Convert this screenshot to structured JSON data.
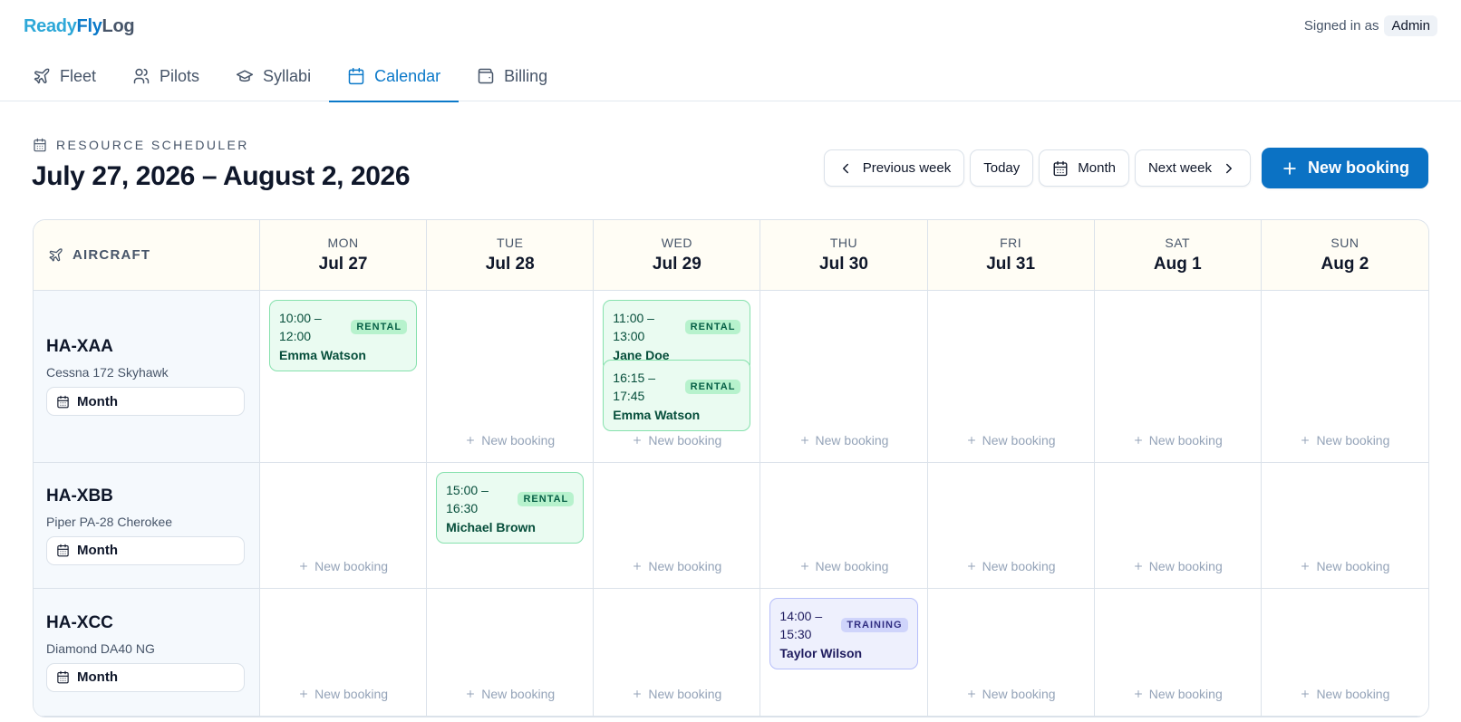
{
  "brand": {
    "part1": "Ready",
    "part2": "Fly",
    "part3": "Log"
  },
  "user": {
    "signed_in_label": "Signed in as",
    "name": "Admin"
  },
  "nav": {
    "tabs": [
      {
        "label": "Fleet",
        "icon": "plane-icon"
      },
      {
        "label": "Pilots",
        "icon": "users-icon"
      },
      {
        "label": "Syllabi",
        "icon": "graduation-cap-icon"
      },
      {
        "label": "Calendar",
        "icon": "calendar-icon",
        "active": true
      },
      {
        "label": "Billing",
        "icon": "wallet-icon"
      }
    ]
  },
  "page": {
    "eyebrow": "RESOURCE SCHEDULER",
    "title": "July 27, 2026 – August 2, 2026"
  },
  "toolbar": {
    "prev_week": "Previous week",
    "today": "Today",
    "month": "Month",
    "next_week": "Next week",
    "new_booking": "New booking"
  },
  "grid": {
    "corner_label": "AIRCRAFT",
    "days": [
      {
        "dow": "MON",
        "date": "Jul 27"
      },
      {
        "dow": "TUE",
        "date": "Jul 28"
      },
      {
        "dow": "WED",
        "date": "Jul 29"
      },
      {
        "dow": "THU",
        "date": "Jul 30"
      },
      {
        "dow": "FRI",
        "date": "Jul 31"
      },
      {
        "dow": "SAT",
        "date": "Aug 1"
      },
      {
        "dow": "SUN",
        "date": "Aug 2"
      }
    ],
    "new_booking_label": "New booking",
    "resources": [
      {
        "registration": "HA-XAA",
        "model": "Cessna 172 Skyhawk",
        "month_label": "Month"
      },
      {
        "registration": "HA-XBB",
        "model": "Piper PA-28 Cherokee",
        "month_label": "Month"
      },
      {
        "registration": "HA-XCC",
        "model": "Diamond DA40 NG",
        "month_label": "Month"
      }
    ],
    "bookings": [
      {
        "resource": 0,
        "day": 0,
        "time": "10:00 – 12:00",
        "tag": "RENTAL",
        "pilot": "Emma Watson"
      },
      {
        "resource": 0,
        "day": 2,
        "time": "11:00 – 13:00",
        "tag": "RENTAL",
        "pilot": "Jane Doe"
      },
      {
        "resource": 0,
        "day": 2,
        "time": "16:15 – 17:45",
        "tag": "RENTAL",
        "pilot": "Emma Watson"
      },
      {
        "resource": 1,
        "day": 1,
        "time": "15:00 – 16:30",
        "tag": "RENTAL",
        "pilot": "Michael Brown"
      },
      {
        "resource": 2,
        "day": 3,
        "time": "14:00 – 15:30",
        "tag": "TRAINING",
        "pilot": "Taylor Wilson"
      }
    ]
  },
  "colors": {
    "accent": "#0b72c4",
    "rental_bg": "#eafbf1",
    "training_bg": "#eef0fd",
    "header_bg": "#fffdf5",
    "resource_bg": "#f5f9fd"
  }
}
